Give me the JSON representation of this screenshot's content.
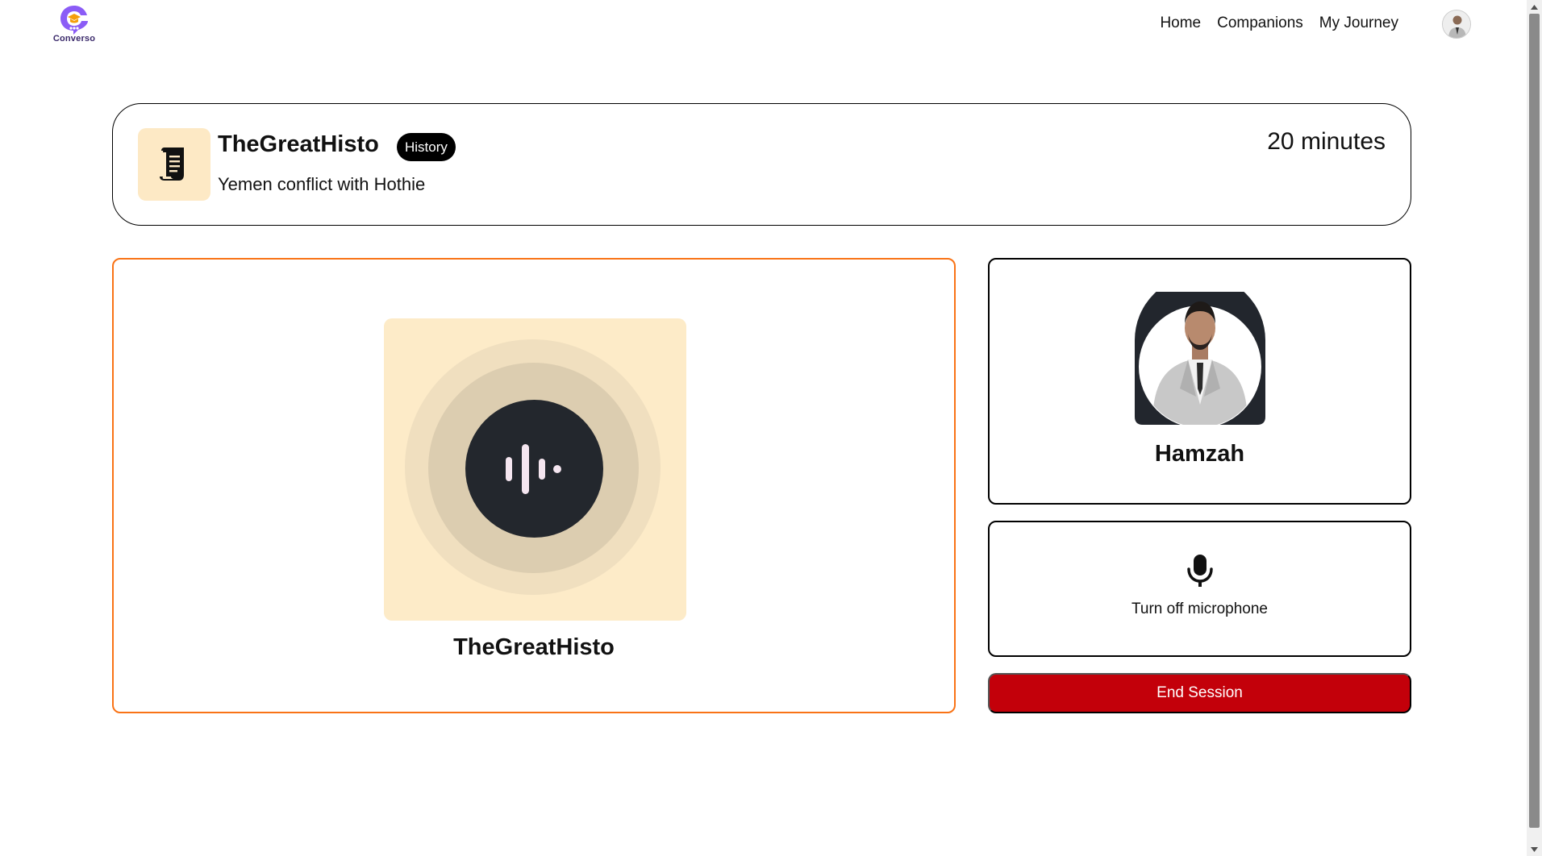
{
  "navbar": {
    "logo_text": "Converso",
    "links": [
      "Home",
      "Companions",
      "My Journey"
    ],
    "avatar_icon": "user-avatar"
  },
  "companion": {
    "name": "TheGreatHisto",
    "subject": "History",
    "topic": "Yemen conflict with Hothie",
    "duration": "20 minutes",
    "subject_icon": "scroll-icon"
  },
  "session": {
    "companion_name": "TheGreatHisto",
    "voice_icon": "audio-wave-icon",
    "user_name": "Hamzah",
    "mic_label": "Turn off microphone",
    "mic_icon": "microphone-icon",
    "end_label": "End Session"
  },
  "colors": {
    "accent_orange": "#f97316",
    "end_red": "#c3000a",
    "subject_bg": "#fde9c5",
    "logo_purple": "#8b5cf6"
  }
}
